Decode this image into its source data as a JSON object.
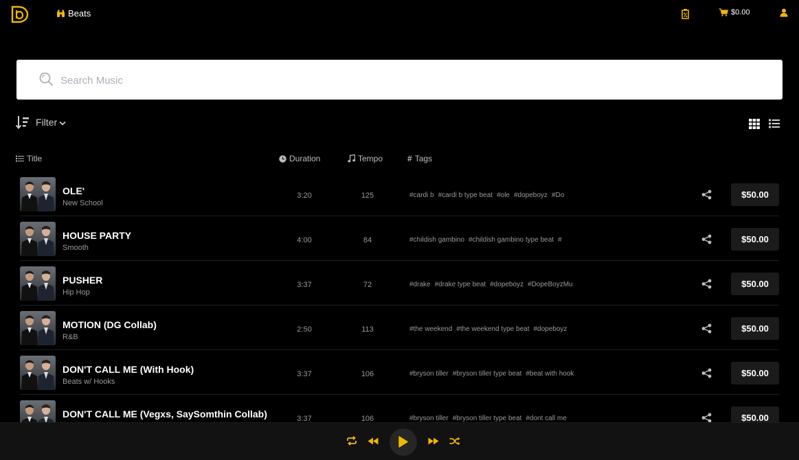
{
  "nav": {
    "beats_label": "Beats",
    "cart_total": "$0.00"
  },
  "search": {
    "placeholder": "Search Music"
  },
  "filter": {
    "label": "Filter"
  },
  "columns": {
    "title": "Title",
    "duration": "Duration",
    "tempo": "Tempo",
    "tags": "Tags"
  },
  "tracks": [
    {
      "title": "OLE'",
      "genre": "New School",
      "duration": "3:20",
      "tempo": "125",
      "tags": [
        "#cardi b",
        "#cardi b type beat",
        "#ole",
        "#dopeboyz",
        "#Do"
      ],
      "price": "$50.00"
    },
    {
      "title": "HOUSE PARTY",
      "genre": "Smooth",
      "duration": "4:00",
      "tempo": "84",
      "tags": [
        "#childish gambino",
        "#childish gambino type beat",
        "#"
      ],
      "price": "$50.00"
    },
    {
      "title": "PUSHER",
      "genre": "Hip Hop",
      "duration": "3:37",
      "tempo": "72",
      "tags": [
        "#drake",
        "#drake type beat",
        "#dopeboyz",
        "#DopeBoyzMu"
      ],
      "price": "$50.00"
    },
    {
      "title": "MOTION (DG Collab)",
      "genre": "R&B",
      "duration": "2:50",
      "tempo": "113",
      "tags": [
        "#the weekend",
        "#the weekend type beat",
        "#dopeboyz"
      ],
      "price": "$50.00"
    },
    {
      "title": "DON'T CALL ME (With Hook)",
      "genre": "Beats w/ Hooks",
      "duration": "3:37",
      "tempo": "106",
      "tags": [
        "#bryson tiller",
        "#bryson tiller type beat",
        "#beat with hook"
      ],
      "price": "$50.00"
    },
    {
      "title": "DON'T CALL ME (Vegxs, SaySomthin Collab)",
      "genre": "",
      "duration": "3:37",
      "tempo": "106",
      "tags": [
        "#bryson tiller",
        "#bryson tiller type beat",
        "#dont call me"
      ],
      "price": "$50.00"
    }
  ],
  "colors": {
    "accent": "#f2b705",
    "background": "#000000",
    "price_button": "#1b1b1b",
    "player_bar": "#121212"
  },
  "icons": {
    "logo": "db-logo-icon",
    "beats": "binoculars-icon",
    "discount": "discount-tag-icon",
    "cart": "cart-icon",
    "user": "user-icon",
    "search": "search-icon",
    "sort": "sort-icon",
    "grid_view": "grid-view-icon",
    "list_view": "list-view-icon",
    "share": "share-icon",
    "repeat": "repeat-icon",
    "previous": "rewind-icon",
    "play": "play-icon",
    "next": "fast-forward-icon",
    "shuffle": "shuffle-icon"
  }
}
